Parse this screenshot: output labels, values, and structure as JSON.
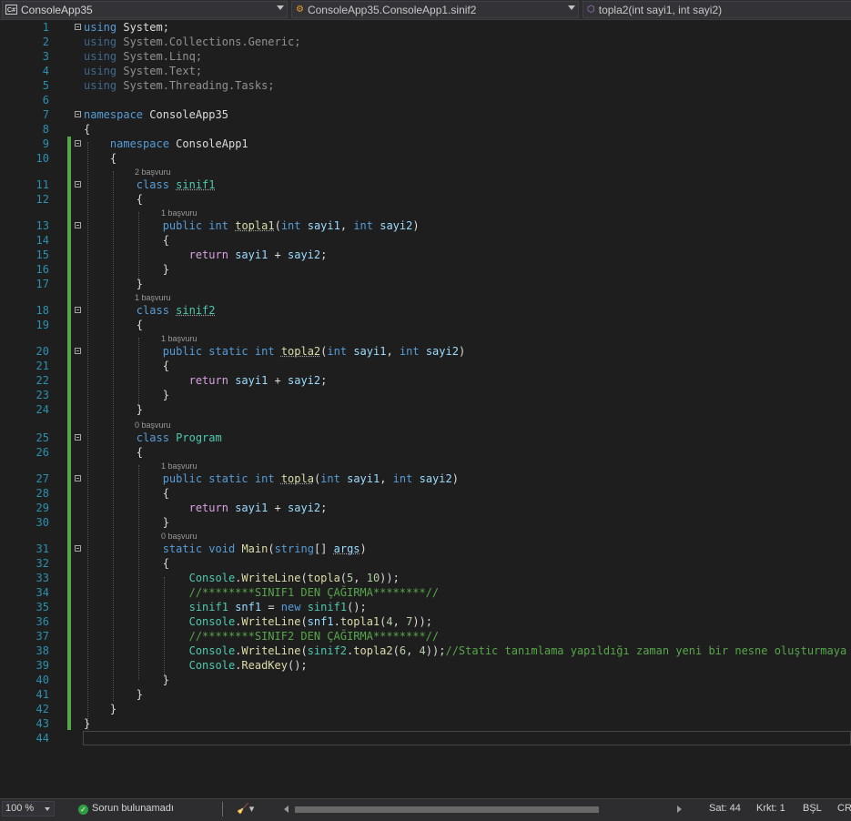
{
  "navigation_bar": {
    "project": "ConsoleApp35",
    "type": "ConsoleApp35.ConsoleApp1.sinif2",
    "member": "topla2(int sayi1, int sayi2)"
  },
  "editor": {
    "line_numbers": [
      "1",
      "2",
      "3",
      "4",
      "5",
      "6",
      "7",
      "8",
      "9",
      "10",
      "11",
      "12",
      "13",
      "14",
      "15",
      "16",
      "17",
      "18",
      "19",
      "20",
      "21",
      "22",
      "23",
      "24",
      "25",
      "26",
      "27",
      "28",
      "29",
      "30",
      "31",
      "32",
      "33",
      "34",
      "35",
      "36",
      "37",
      "38",
      "39",
      "40",
      "41",
      "42",
      "43",
      "44"
    ],
    "codelens": {
      "sinif1": "2 başvuru",
      "topla1": "1 başvuru",
      "sinif2": "1 başvuru",
      "topla2": "1 başvuru",
      "program": "0 başvuru",
      "topla": "1 başvuru",
      "main": "0 başvuru"
    },
    "tokens": {
      "using": "using",
      "system": "System;",
      "collections": "System.Collections.Generic;",
      "linq": "System.Linq;",
      "text": "System.Text;",
      "threading": "System.Threading.Tasks;",
      "namespace": "namespace",
      "ns_outer": "ConsoleApp35",
      "ns_inner": "ConsoleApp1",
      "open_brace": "{",
      "close_brace": "}",
      "class": "class",
      "sinif1": "sinif1",
      "sinif2": "sinif2",
      "program": "Program",
      "public": "public",
      "static": "static",
      "int": "int",
      "void": "void",
      "string": "string",
      "return": "return",
      "new": "new",
      "topla1": "topla1",
      "topla2": "topla2",
      "topla": "topla",
      "main": "Main",
      "console": "Console",
      "writeline": "WriteLine",
      "readkey": "ReadKey",
      "sayi1": "sayi1",
      "sayi2": "sayi2",
      "args": "args",
      "snf1": "snf1",
      "n5": "5",
      "n10": "10",
      "n4": "4",
      "n7": "7",
      "n6": "6",
      "comment1": "//********SINIF1 DEN ÇAĞIRMA********//",
      "comment2": "//********SINIF2 DEN ÇAĞIRMA********//",
      "comment3": "//Static tanımlama yapıldığı zaman yeni bir nesne oluşturmaya ihti"
    }
  },
  "status_bar": {
    "zoom": "100 %",
    "issues": "Sorun bulunamadı",
    "line": "Sat: 44",
    "column": "Krkt: 1",
    "mode": "BŞL",
    "line_ending": "CRL"
  }
}
